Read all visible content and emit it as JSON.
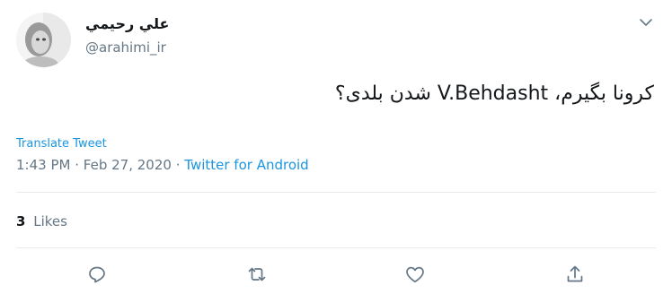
{
  "author": {
    "display_name": "علي رحيمي",
    "handle": "@arahimi_ir"
  },
  "tweet": {
    "text": "کرونا بگیرم، V.Behdasht شدن بلدی؟",
    "translate_label": "Translate Tweet",
    "time": "1:43 PM",
    "separator": "·",
    "date": "Feb 27, 2020",
    "source": "Twitter for Android"
  },
  "stats": {
    "likes_count": "3",
    "likes_label": "Likes"
  },
  "icons": {
    "menu": "chevron-down-icon",
    "reply": "reply-icon",
    "retweet": "retweet-icon",
    "like": "heart-icon",
    "share": "share-icon"
  },
  "colors": {
    "link": "#1b95e0",
    "secondary_text": "#657786",
    "primary_text": "#14171a",
    "divider": "#e6ecf0"
  }
}
